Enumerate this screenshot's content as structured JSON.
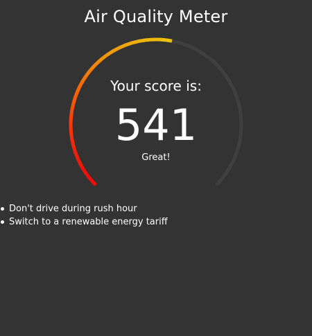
{
  "header": {
    "title": "Air Quality Meter"
  },
  "gauge": {
    "score_label": "Your score is:",
    "score": 541,
    "rating": "Great!",
    "fill_fraction": 0.54,
    "colors": {
      "track": "#3f3f3f",
      "gradient_start": "#ee0a0a",
      "gradient_mid": "#f76508",
      "gradient_end": "#e9c40a"
    }
  },
  "tips": [
    {
      "text": "Don't drive during rush hour"
    },
    {
      "text": "Switch to a renewable energy tariff"
    }
  ]
}
